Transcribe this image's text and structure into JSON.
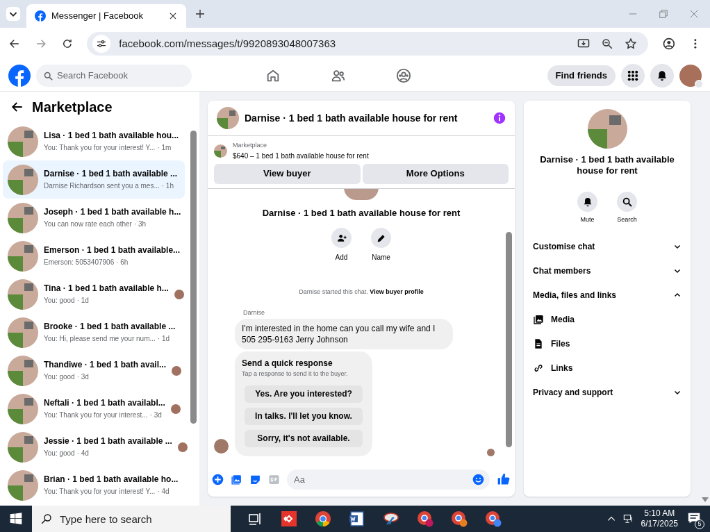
{
  "browser": {
    "tab_title": "Messenger | Facebook",
    "url": "facebook.com/messages/t/9920893048007363"
  },
  "header": {
    "search_placeholder": "Search Facebook",
    "find_friends": "Find friends"
  },
  "sidebar": {
    "title": "Marketplace",
    "conversations": [
      {
        "name": "Lisa · 1 bed 1 bath available hou...",
        "preview": "You: Thank you for your interest! Y...",
        "time": "· 1m",
        "selected": false,
        "seen_avatar": false
      },
      {
        "name": "Darnise · 1 bed 1 bath available ...",
        "preview": "Darnise Richardson sent you a mes...",
        "time": "· 1h",
        "selected": true,
        "seen_avatar": false
      },
      {
        "name": "Joseph · 1 bed 1 bath available h...",
        "preview": "You can now rate each other",
        "time": "· 3h",
        "selected": false,
        "seen_avatar": false
      },
      {
        "name": "Emerson · 1 bed 1 bath available...",
        "preview": "Emerson: 5053407906",
        "time": "· 6h",
        "selected": false,
        "seen_avatar": false
      },
      {
        "name": "Tina · 1 bed 1 bath available h...",
        "preview": "You: good",
        "time": "· 1d",
        "selected": false,
        "seen_avatar": true
      },
      {
        "name": "Brooke · 1 bed 1 bath available ...",
        "preview": "You: Hi, please send me your num...",
        "time": "· 1d",
        "selected": false,
        "seen_avatar": false
      },
      {
        "name": "Thandiwe · 1 bed 1 bath avail...",
        "preview": "You: good",
        "time": "· 3d",
        "selected": false,
        "seen_avatar": true
      },
      {
        "name": "Neftali · 1 bed 1 bath availabl...",
        "preview": "You: Thank you for your interest...",
        "time": "· 3d",
        "selected": false,
        "seen_avatar": true
      },
      {
        "name": "Jessie · 1 bed 1 bath available ...",
        "preview": "You: good",
        "time": "· 4d",
        "selected": false,
        "seen_avatar": true
      },
      {
        "name": "Brian · 1 bed 1 bath available ho...",
        "preview": "You: Thank you for your interest! Y...",
        "time": "· 4d",
        "selected": false,
        "seen_avatar": false
      }
    ]
  },
  "chat": {
    "title": "Darnise · 1 bed 1 bath available house for rent",
    "listing_label": "Marketplace",
    "listing": "$640 – 1 bed 1 bath available house for rent",
    "buttons": [
      "View buyer",
      "More Options"
    ],
    "intro_title": "Darnise · 1 bed 1 bath available house for rent",
    "intro_actions": [
      "Add",
      "Name"
    ],
    "system_text": "Darnise started this chat.",
    "system_link": "View buyer profile",
    "sender": "Darnise",
    "message": "I'm interested in the home can you call my wife and I 505 295-9163 Jerry Johnson",
    "quick_title": "Send a quick response",
    "quick_hint": "Tap a response to send it to the buyer.",
    "quick_responses": [
      "Yes. Are you interested?",
      "In talks. I'll let you know.",
      "Sorry, it's not available."
    ],
    "composer_placeholder": "Aa"
  },
  "details": {
    "title": "Darnise · 1 bed 1 bath available house for rent",
    "actions": [
      "Mute",
      "Search"
    ],
    "sections": [
      {
        "label": "Customise chat",
        "expanded": false
      },
      {
        "label": "Chat members",
        "expanded": false
      },
      {
        "label": "Media, files and links",
        "expanded": true,
        "children": [
          {
            "label": "Media",
            "kind": "media"
          },
          {
            "label": "Files",
            "kind": "files"
          },
          {
            "label": "Links",
            "kind": "links"
          }
        ]
      },
      {
        "label": "Privacy and support",
        "expanded": false
      }
    ]
  },
  "taskbar": {
    "search_placeholder": "Type here to search",
    "time": "5:10 AM",
    "date": "6/17/2025",
    "notifications": "5"
  }
}
